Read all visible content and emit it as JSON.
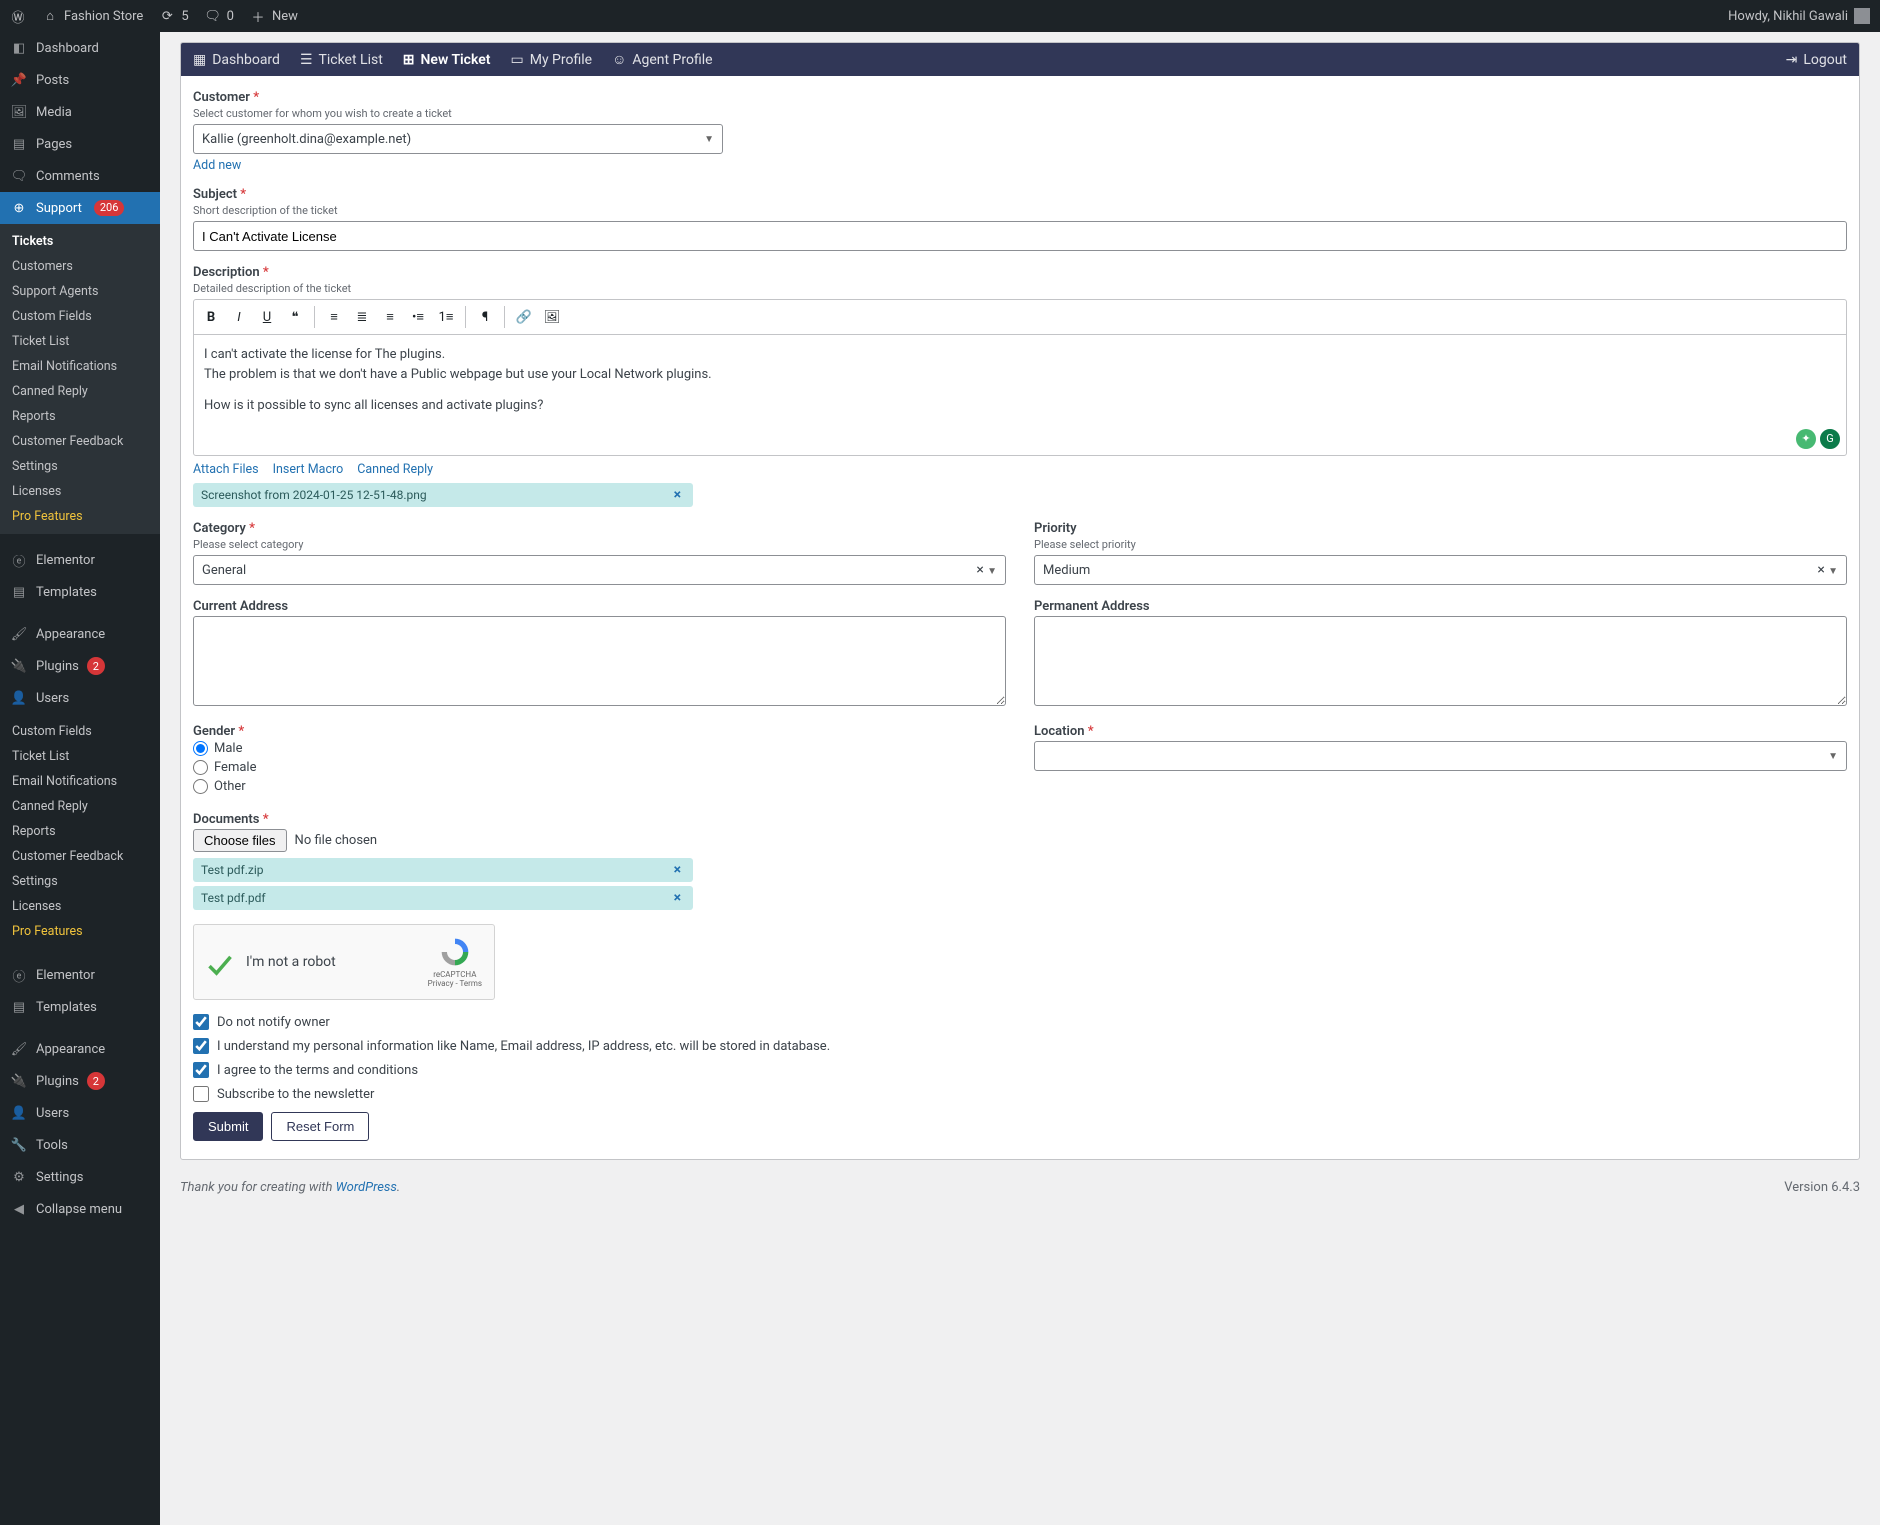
{
  "adminBar": {
    "siteName": "Fashion Store",
    "refreshCount": "5",
    "commentsCount": "0",
    "newLabel": "New",
    "howdy": "Howdy, Nikhil Gawali"
  },
  "sidebar": {
    "dashboard": "Dashboard",
    "posts": "Posts",
    "media": "Media",
    "pages": "Pages",
    "comments": "Comments",
    "support": "Support",
    "supportBadge": "206",
    "supportSub": {
      "tickets": "Tickets",
      "customers": "Customers",
      "supportAgents": "Support Agents",
      "customFields": "Custom Fields",
      "ticketList": "Ticket List",
      "emailNotifications": "Email Notifications",
      "cannedReply": "Canned Reply",
      "reports": "Reports",
      "customerFeedback": "Customer Feedback",
      "settings": "Settings",
      "licenses": "Licenses",
      "proFeatures": "Pro Features"
    },
    "elementor": "Elementor",
    "templates": "Templates",
    "appearance": "Appearance",
    "plugins": "Plugins",
    "pluginsBadge": "2",
    "users": "Users",
    "dupSub": {
      "customFields": "Custom Fields",
      "ticketList": "Ticket List",
      "emailNotifications": "Email Notifications",
      "cannedReply": "Canned Reply",
      "reports": "Reports",
      "customerFeedback": "Customer Feedback",
      "settings": "Settings",
      "licenses": "Licenses",
      "proFeatures": "Pro Features"
    },
    "elementor2": "Elementor",
    "templates2": "Templates",
    "appearance2": "Appearance",
    "plugins2": "Plugins",
    "plugins2Badge": "2",
    "users2": "Users",
    "tools": "Tools",
    "settingsMain": "Settings",
    "collapse": "Collapse menu"
  },
  "scope": {
    "tabs": {
      "dashboard": "Dashboard",
      "ticketList": "Ticket List",
      "newTicket": "New Ticket",
      "myProfile": "My Profile",
      "agentProfile": "Agent Profile",
      "logout": "Logout"
    }
  },
  "form": {
    "customer": {
      "label": "Customer",
      "hint": "Select customer for whom you wish to create a ticket",
      "value": "Kallie (greenholt.dina@example.net)",
      "addNew": "Add new"
    },
    "subject": {
      "label": "Subject",
      "hint": "Short description of the ticket",
      "value": "I Can't Activate License"
    },
    "description": {
      "label": "Description",
      "hint": "Detailed description of the ticket",
      "line1": "I can't activate the license for The plugins.",
      "line2": "The problem is that we don't have a Public webpage but use your Local Network plugins.",
      "line3": "How is it possible to sync all licenses and activate plugins?"
    },
    "attachLinks": {
      "attach": "Attach Files",
      "macro": "Insert Macro",
      "canned": "Canned Reply"
    },
    "attachment1": "Screenshot from 2024-01-25 12-51-48.png",
    "category": {
      "label": "Category",
      "hint": "Please select category",
      "value": "General"
    },
    "priority": {
      "label": "Priority",
      "hint": "Please select priority",
      "value": "Medium"
    },
    "currentAddress": {
      "label": "Current Address"
    },
    "permanentAddress": {
      "label": "Permanent Address"
    },
    "gender": {
      "label": "Gender",
      "male": "Male",
      "female": "Female",
      "other": "Other"
    },
    "location": {
      "label": "Location"
    },
    "documents": {
      "label": "Documents",
      "choose": "Choose files",
      "noFile": "No file chosen",
      "file1": "Test pdf.zip",
      "file2": "Test pdf.pdf"
    },
    "recaptcha": {
      "label": "I'm not a robot",
      "brand": "reCAPTCHA",
      "meta": "Privacy - Terms"
    },
    "checks": {
      "notify": "Do not notify owner",
      "consent": "I understand my personal information like Name, Email address, IP address, etc. will be stored in database.",
      "terms": "I agree to the terms and conditions",
      "newsletter": "Subscribe to the newsletter"
    },
    "buttons": {
      "submit": "Submit",
      "reset": "Reset Form"
    }
  },
  "footer": {
    "thanks": "Thank you for creating with ",
    "wp": "WordPress",
    "dot": ".",
    "version": "Version 6.4.3"
  }
}
